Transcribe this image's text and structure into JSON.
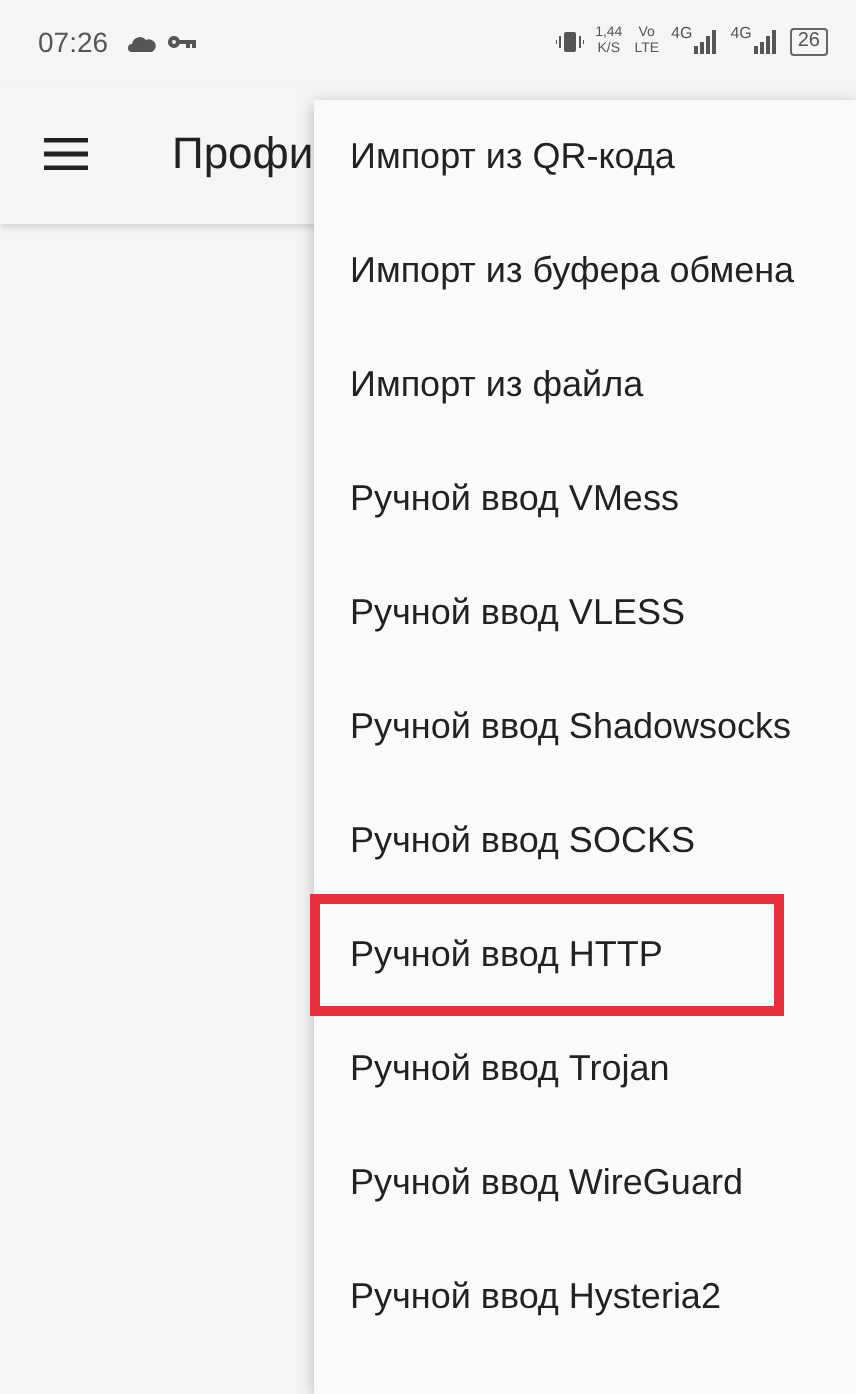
{
  "status_bar": {
    "time": "07:26",
    "speed": "1,44",
    "speed_unit": "K/S",
    "volte_top": "Vo",
    "volte_bottom": "LTE",
    "network_1": "4G",
    "network_2": "4G",
    "battery": "26"
  },
  "toolbar": {
    "title": "Профи"
  },
  "menu": {
    "items": [
      {
        "label": "Импорт из QR-кода",
        "highlighted": false
      },
      {
        "label": "Импорт из буфера обмена",
        "highlighted": false
      },
      {
        "label": "Импорт из файла",
        "highlighted": false
      },
      {
        "label": "Ручной ввод VMess",
        "highlighted": false
      },
      {
        "label": "Ручной ввод VLESS",
        "highlighted": false
      },
      {
        "label": "Ручной ввод Shadowsocks",
        "highlighted": false
      },
      {
        "label": "Ручной ввод SOCKS",
        "highlighted": false
      },
      {
        "label": "Ручной ввод HTTP",
        "highlighted": true
      },
      {
        "label": "Ручной ввод Trojan",
        "highlighted": false
      },
      {
        "label": "Ручной ввод WireGuard",
        "highlighted": false
      },
      {
        "label": "Ручной ввод Hysteria2",
        "highlighted": false
      }
    ]
  }
}
